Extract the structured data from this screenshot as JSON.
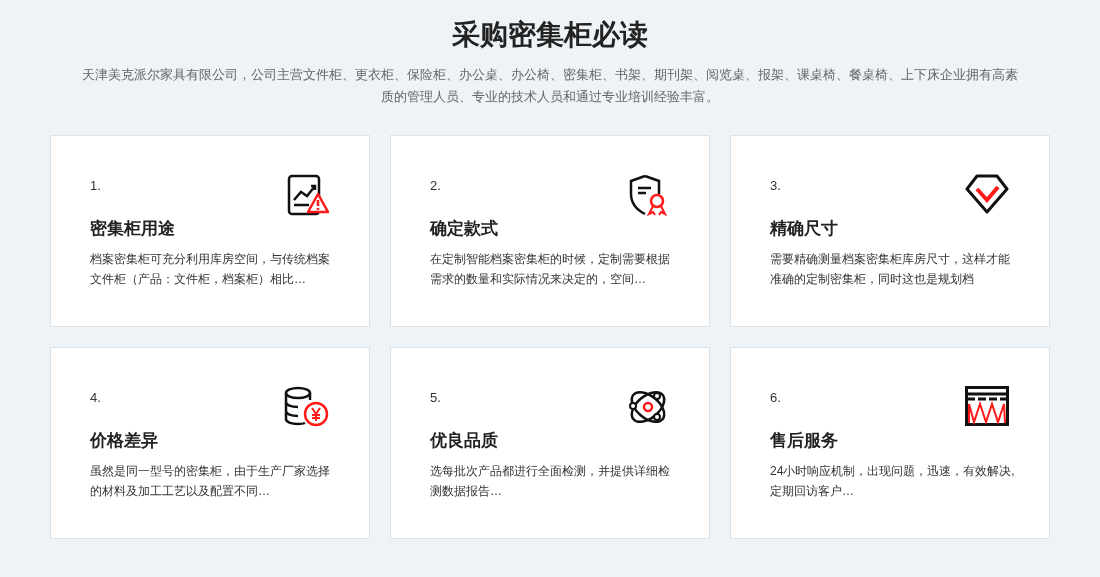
{
  "title": "采购密集柜必读",
  "subtitle": "天津美克派尔家具有限公司，公司主营文件柜、更衣柜、保险柜、办公桌、办公椅、密集柜、书架、期刊架、阅览桌、报架、课桌椅、餐桌椅、上下床企业拥有高素质的管理人员、专业的技术人员和通过专业培训经验丰富。",
  "cards": [
    {
      "number": "1.",
      "title": "密集柜用途",
      "text": "档案密集柜可充分利用库房空间，与传统档案文件柜（产品：文件柜，档案柜）相比…"
    },
    {
      "number": "2.",
      "title": "确定款式",
      "text": "在定制智能档案密集柜的时候，定制需要根据需求的数量和实际情况来决定的，空间…"
    },
    {
      "number": "3.",
      "title": "精确尺寸",
      "text": "需要精确测量档案密集柜库房尺寸，这样才能准确的定制密集柜，同时这也是规划档"
    },
    {
      "number": "4.",
      "title": "价格差异",
      "text": "虽然是同一型号的密集柜，由于生产厂家选择的材料及加工工艺以及配置不同…"
    },
    {
      "number": "5.",
      "title": "优良品质",
      "text": "选每批次产品都进行全面检测，并提供详细检测数据报告…"
    },
    {
      "number": "6.",
      "title": "售后服务",
      "text": "24小时响应机制，出现问题，迅速，有效解决,定期回访客户…"
    }
  ]
}
